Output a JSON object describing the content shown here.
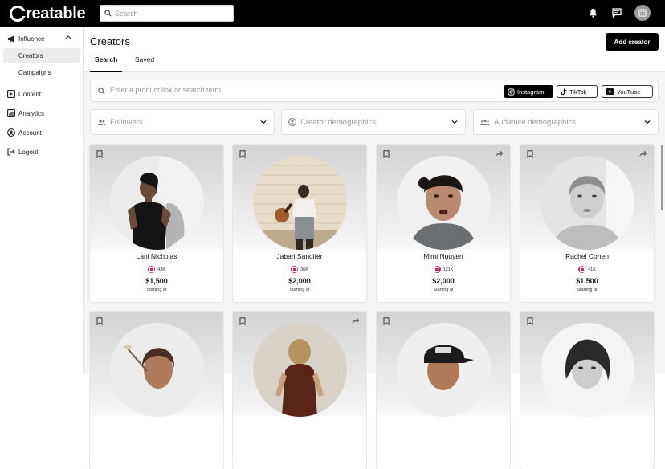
{
  "app": {
    "brand": "reatable"
  },
  "topbar": {
    "search_placeholder": "Search"
  },
  "sidebar": {
    "influence": "Influence",
    "creators": "Creators",
    "campaigns": "Campaigns",
    "content": "Content",
    "analytics": "Analytics",
    "account": "Account",
    "logout": "Logout"
  },
  "main": {
    "title": "Creators",
    "add_label": "Add creator",
    "tabs": [
      "Search",
      "Saved"
    ],
    "search_placeholder": "Enter a product link or search term",
    "platforms": [
      "Instagram",
      "TikTok",
      "YouTube"
    ],
    "filters": [
      "Followers",
      "Creator demographics",
      "Audience demographics"
    ]
  },
  "creators": [
    {
      "name": "Lani Nicholas",
      "followers": "43K",
      "price": "$1,500",
      "price_note": "Starting at"
    },
    {
      "name": "Jabari Sandifer",
      "followers": "36K",
      "price": "$2,000",
      "price_note": "Starting at"
    },
    {
      "name": "Mimi Nguyen",
      "followers": "121K",
      "price": "$2,000",
      "price_note": "Starting at"
    },
    {
      "name": "Rachel Cohen",
      "followers": "41K",
      "price": "$1,500",
      "price_note": "Starting at"
    }
  ]
}
